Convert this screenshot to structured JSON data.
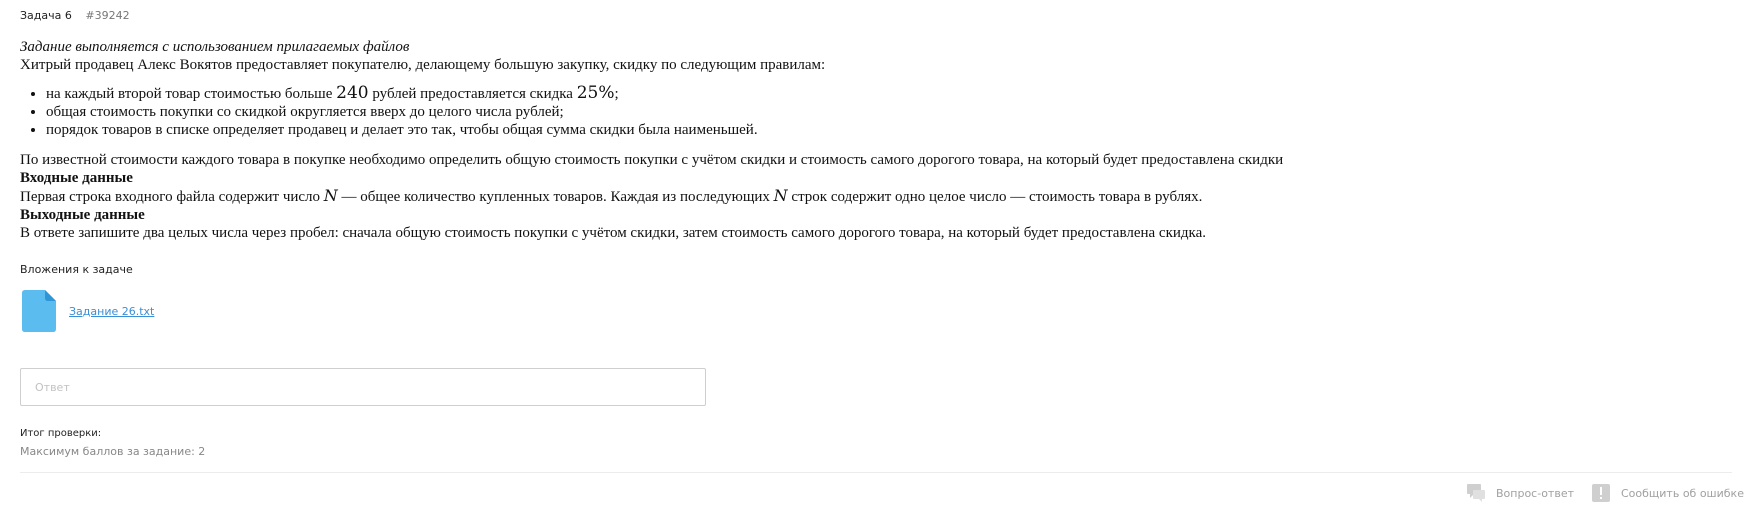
{
  "task": {
    "title": "Задача 6",
    "number": "#39242"
  },
  "statement": {
    "note": "Задание выполняется с использованием прилагаемых файлов",
    "intro": "Хитрый продавец Алекс Вокятов предоставляет покупателю, делающему большую закупку, скидку по следующим правилам:",
    "rule1_before": "на каждый второй товар стоимостью больше ",
    "rule1_price": "240",
    "rule1_middle": " рублей предоставляется скидка ",
    "rule1_discount": "25%",
    "rule1_after": ";",
    "rule2": "общая стоимость покупки со скидкой округляется вверх до целого числа рублей;",
    "rule3": "порядок товаров в списке определяет продавец и делает это так, чтобы общая сумма скидки была наименьшей.",
    "task_text": "По известной стоимости каждого товара в покупке необходимо определить общую стоимость покупки с учётом скидки и стоимость самого дорогого товара, на который будет предоставлена скидки",
    "input_heading": "Входные данные",
    "input_before": "Первая строка входного файла содержит число ",
    "input_var": "N",
    "input_middle": " — общее количество купленных товаров. Каждая из последующих ",
    "input_var2": "N",
    "input_after": " строк содержит одно целое число — стоимость товара в рублях.",
    "output_heading": "Выходные данные",
    "output_text": "В ответе запишите два целых числа через пробел: сначала общую стоимость покупки с учётом скидки, затем стоимость самого дорогого товара, на который будет предоставлена скидка."
  },
  "attachments": {
    "title": "Вложения к задаче",
    "files": [
      {
        "name": "Задание 26.txt",
        "icon": "file-icon"
      }
    ]
  },
  "answer": {
    "placeholder": "Ответ",
    "value": ""
  },
  "result": {
    "label": "Итог проверки:",
    "max_score": "Максимум баллов за задание: 2"
  },
  "footer": {
    "question_label": "Вопрос-ответ",
    "report_label": "Сообщить об ошибке"
  },
  "colors": {
    "link": "#3a8fd6",
    "file_icon": "#5bbcf0",
    "footer_icon": "#cfcfcf",
    "muted": "#a0a0a0"
  }
}
